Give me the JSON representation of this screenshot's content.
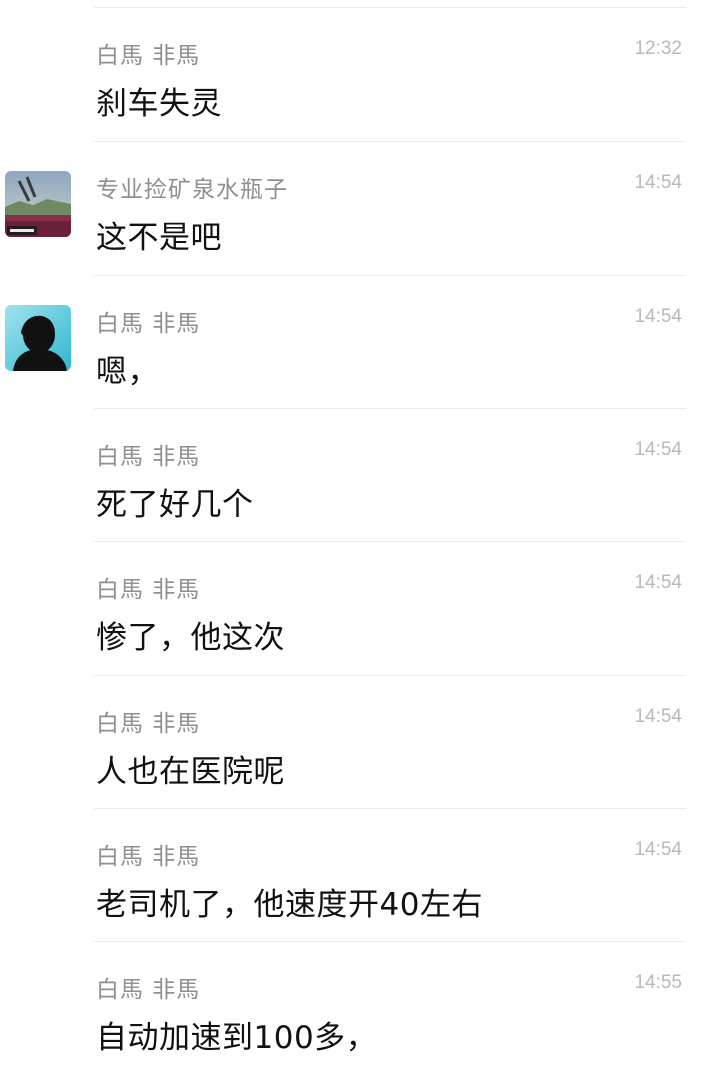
{
  "messages": [
    {
      "sender": "白馬 非馬",
      "time": "12:32",
      "text": "刹车失灵",
      "avatar": "none"
    },
    {
      "sender": "专业捡矿泉水瓶子",
      "time": "14:54",
      "text": "这不是吧",
      "avatar": "landscape-photo"
    },
    {
      "sender": "白馬 非馬",
      "time": "14:54",
      "text": "嗯，",
      "avatar": "silhouette"
    },
    {
      "sender": "白馬 非馬",
      "time": "14:54",
      "text": "死了好几个",
      "avatar": "none"
    },
    {
      "sender": "白馬 非馬",
      "time": "14:54",
      "text": "惨了，他这次",
      "avatar": "none"
    },
    {
      "sender": "白馬 非馬",
      "time": "14:54",
      "text": "人也在医院呢",
      "avatar": "none"
    },
    {
      "sender": "白馬 非馬",
      "time": "14:54",
      "text": "老司机了，他速度开40左右",
      "avatar": "none"
    },
    {
      "sender": "白馬 非馬",
      "time": "14:55",
      "text": "自动加速到100多，",
      "avatar": "none"
    }
  ],
  "colors": {
    "sender": "#8f8f8f",
    "time": "#b9b9b9",
    "text": "#111111",
    "divider": "#ececec"
  }
}
